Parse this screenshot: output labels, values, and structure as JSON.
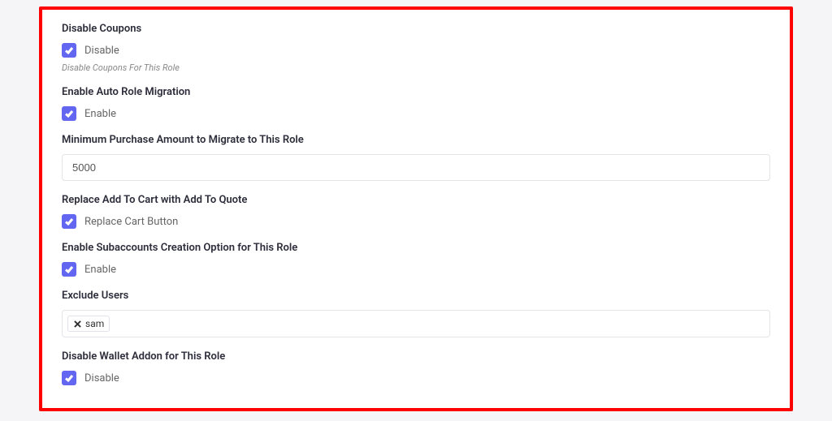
{
  "fields": {
    "disable_coupons": {
      "title": "Disable Coupons",
      "label": "Disable",
      "help": "Disable Coupons For This Role"
    },
    "auto_role_migration": {
      "title": "Enable Auto Role Migration",
      "label": "Enable"
    },
    "min_purchase": {
      "title": "Minimum Purchase Amount to Migrate to This Role",
      "value": "5000"
    },
    "replace_cart": {
      "title": "Replace Add To Cart with Add To Quote",
      "label": "Replace Cart Button"
    },
    "subaccounts": {
      "title": "Enable Subaccounts Creation Option for This Role",
      "label": "Enable"
    },
    "exclude_users": {
      "title": "Exclude Users",
      "tags": [
        "sam"
      ]
    },
    "disable_wallet": {
      "title": "Disable Wallet Addon for This Role",
      "label": "Disable"
    }
  }
}
